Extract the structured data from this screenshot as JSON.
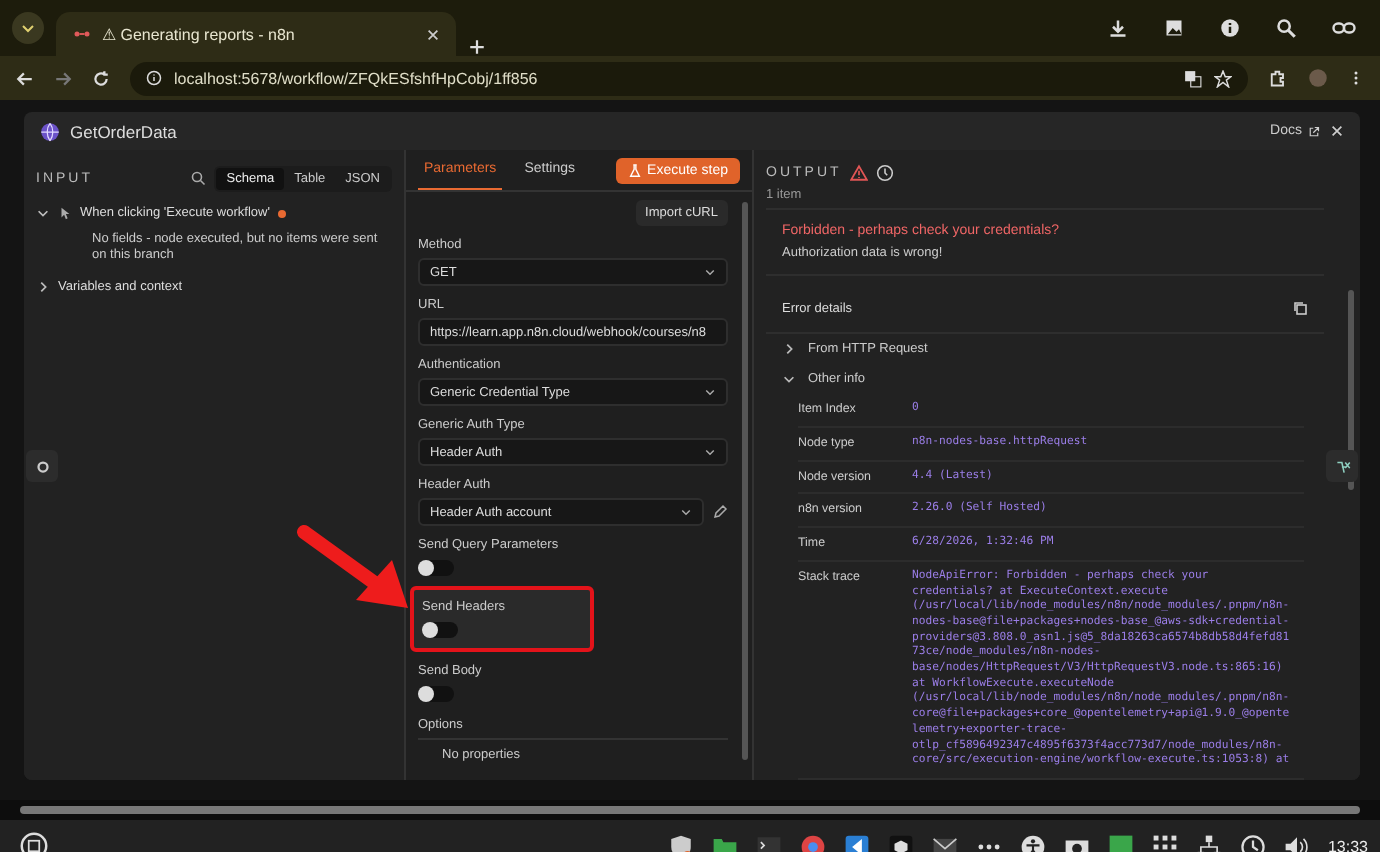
{
  "browser": {
    "tabs": [
      {
        "title": "⚠ Generating reports - n8n",
        "selected": true
      }
    ],
    "url": "localhost:5678/workflow/ZFQkESfshfHpCobj/1ff856"
  },
  "modal": {
    "title": "GetOrderData",
    "docs": "Docs"
  },
  "input": {
    "title": "INPUT",
    "tabs": [
      {
        "label": "Schema",
        "selected": true
      },
      {
        "label": "Table",
        "selected": false
      },
      {
        "label": "JSON",
        "selected": false
      }
    ],
    "tree": [
      {
        "label": "When clicking 'Execute workflow'",
        "expanded": true,
        "message": "No fields - node executed, but no items were sent on this branch"
      },
      {
        "label": "Variables and context",
        "expanded": false
      }
    ]
  },
  "parameters": {
    "tabs": [
      {
        "label": "Parameters",
        "selected": true
      },
      {
        "label": "Settings",
        "selected": false
      }
    ],
    "execute_button": "Execute step",
    "import_button": "Import cURL",
    "fields": [
      {
        "kind": "select",
        "label": "Method",
        "value": "GET"
      },
      {
        "kind": "text",
        "label": "URL",
        "value": "https://learn.app.n8n.cloud/webhook/courses/n8"
      },
      {
        "kind": "select",
        "label": "Authentication",
        "value": "Generic Credential Type"
      },
      {
        "kind": "select",
        "label": "Generic Auth Type",
        "value": "Header Auth"
      },
      {
        "kind": "credential",
        "label": "Header Auth",
        "value": "Header Auth account"
      },
      {
        "kind": "toggle",
        "label": "Send Query Parameters",
        "on": false,
        "highlighted": false
      },
      {
        "kind": "toggle",
        "label": "Send Headers",
        "on": false,
        "highlighted": true
      },
      {
        "kind": "toggle",
        "label": "Send Body",
        "on": false,
        "highlighted": false
      },
      {
        "kind": "collection",
        "label": "Options",
        "placeholder": "No properties"
      }
    ]
  },
  "output": {
    "title": "OUTPUT",
    "count": "1 item",
    "error": {
      "title": "Forbidden - perhaps check your credentials?",
      "message": "Authorization data is wrong!"
    },
    "details_title": "Error details",
    "sections": [
      {
        "label": "From HTTP Request",
        "expanded": false
      },
      {
        "label": "Other info",
        "expanded": true
      }
    ],
    "rows": [
      {
        "label": "Item Index",
        "value": "0"
      },
      {
        "label": "Node type",
        "value": "n8n-nodes-base.httpRequest"
      },
      {
        "label": "Node version",
        "value": "4.4 (Latest)"
      },
      {
        "label": "n8n version",
        "value": "2.26.0 (Self Hosted)"
      },
      {
        "label": "Time",
        "value": "6/28/2026, 1:32:46 PM"
      },
      {
        "label": "Stack trace",
        "value": "NodeApiError: Forbidden - perhaps check your\ncredentials? at ExecuteContext.execute\n(/usr/local/lib/node_modules/n8n/node_modules/.pnpm/n8n-\nnodes-base@file+packages+nodes-base_@aws-sdk+credential-\nproviders@3.808.0_asn1.js@5_8da18263ca6574b8db58d4fefd81\n73ce/node_modules/n8n-nodes-\nbase/nodes/HttpRequest/V3/HttpRequestV3.node.ts:865:16)\nat WorkflowExecute.executeNode\n(/usr/local/lib/node_modules/n8n/node_modules/.pnpm/n8n-\ncore@file+packages+core_@opentelemetry+api@1.9.0_@opente\nlemetry+exporter-trace-\notlp_cf5896492347c4895f6373f4acc773d7/node_modules/n8n-\ncore/src/execution-engine/workflow-execute.ts:1053:8) at"
      }
    ]
  },
  "taskbar": {
    "clock": "13:33"
  }
}
